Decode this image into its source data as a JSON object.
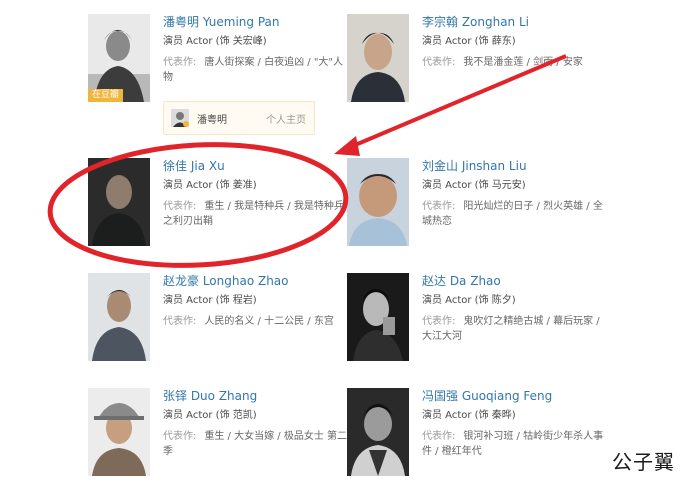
{
  "actors": [
    {
      "name": "潘粤明 Yueming Pan",
      "role": "演员 Actor (饰 关宏峰)",
      "works_label": "代表作:",
      "works": "唐人街探案 / 白夜追凶 / \"大\"人物",
      "badge": "在豆瓣"
    },
    {
      "name": "李宗翰 Zonghan Li",
      "role": "演员 Actor (饰 薛东)",
      "works_label": "代表作:",
      "works": "我不是潘金莲 / 剑雨 / 安家"
    },
    {
      "name": "徐佳 Jia Xu",
      "role": "演员 Actor (饰 姜准)",
      "works_label": "代表作:",
      "works": "重生 / 我是特种兵 / 我是特种兵之利刃出鞘"
    },
    {
      "name": "刘金山 Jinshan Liu",
      "role": "演员 Actor (饰 马元安)",
      "works_label": "代表作:",
      "works": "阳光灿烂的日子 / 烈火英雄 / 全城热恋"
    },
    {
      "name": "赵龙豪 Longhao Zhao",
      "role": "演员 Actor (饰 程岩)",
      "works_label": "代表作:",
      "works": "人民的名义 / 十二公民 / 东宫"
    },
    {
      "name": "赵达 Da Zhao",
      "role": "演员 Actor (饰 陈夕)",
      "works_label": "代表作:",
      "works": "鬼吹灯之精绝古城 / 幕后玩家 / 大江大河"
    },
    {
      "name": "张铎 Duo Zhang",
      "role": "演员 Actor (饰 范凯)",
      "works_label": "代表作:",
      "works": "重生 / 大女当嫁 / 极品女士 第二季"
    },
    {
      "name": "冯国强 Guoqiang Feng",
      "role": "演员 Actor (饰 秦晔)",
      "works_label": "代表作:",
      "works": "银河补习班 / 牯岭街少年杀人事件 / 橙红年代"
    }
  ],
  "popup": {
    "name": "潘粤明",
    "home": "个人主页"
  },
  "watermark": "公子翼",
  "colors": {
    "link": "#3377aa",
    "annotation": "#e0242a",
    "badge": "#f0b53b"
  }
}
